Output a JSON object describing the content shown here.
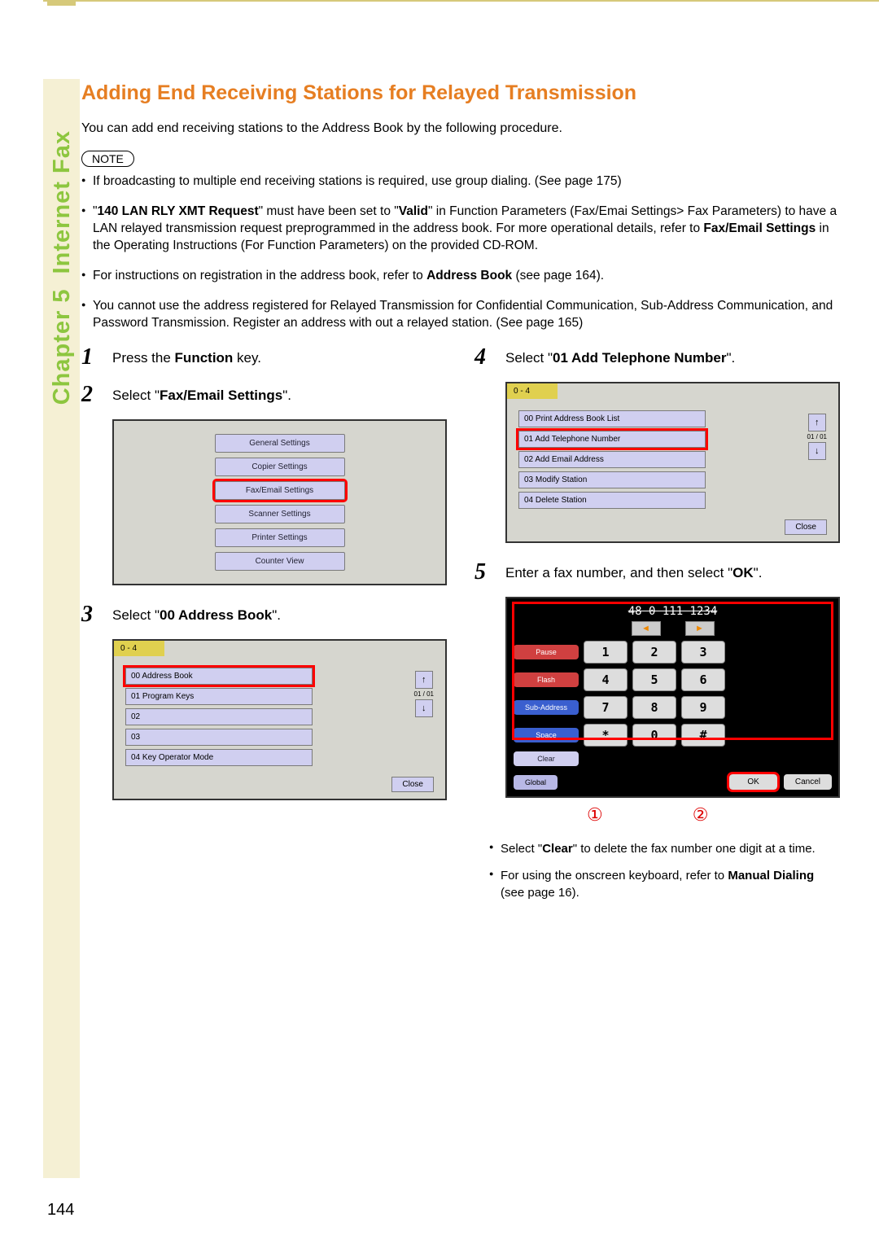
{
  "sidebar": {
    "chapter_label": "Chapter 5",
    "section_label": "Internet Fax"
  },
  "heading": "Adding End Receiving Stations for Relayed Transmission",
  "intro": "You can add end receiving stations to the Address Book by the following procedure.",
  "note_label": "NOTE",
  "notes": {
    "n1": "If broadcasting to multiple end receiving stations is required, use group dialing. (See page 175)",
    "n2a": "\"",
    "n2b": "140 LAN RLY XMT Request",
    "n2c": "\" must have been set to \"",
    "n2d": "Valid",
    "n2e": "\" in Function Parameters (Fax/Emai Settings> Fax Parameters) to have a LAN relayed transmission request preprogrammed in the address book. For more operational details, refer to ",
    "n2f": "Fax/Email Settings",
    "n2g": " in the Operating Instructions (For Function Parameters) on the provided CD-ROM.",
    "n3a": "For instructions on registration in the address book, refer to ",
    "n3b": "Address Book",
    "n3c": " (see page 164).",
    "n4": "You cannot use the address registered for Relayed Transmission for Confidential Communication, Sub-Address Communication, and Password Transmission. Register an address with out a relayed station. (See page 165)"
  },
  "steps": {
    "s1a": "Press the ",
    "s1b": "Function",
    "s1c": " key.",
    "s2a": "Select \"",
    "s2b": "Fax/Email Settings",
    "s2c": "\".",
    "s3a": "Select \"",
    "s3b": "00 Address Book",
    "s3c": "\".",
    "s4a": "Select \"",
    "s4b": "01 Add Telephone Number",
    "s4c": "\".",
    "s5a": "Enter a fax number, and then select \"",
    "s5b": "OK",
    "s5c": "\"."
  },
  "panel1": {
    "items": [
      "General Settings",
      "Copier Settings",
      "Fax/Email Settings",
      "Scanner Settings",
      "Printer Settings",
      "Counter View"
    ]
  },
  "panel3": {
    "hdr": "0 - 4",
    "items": [
      "00  Address Book",
      "01  Program Keys",
      "02",
      "03",
      "04  Key Operator Mode"
    ],
    "close": "Close",
    "page": "01 / 01"
  },
  "panel4": {
    "hdr": "0 - 4",
    "items": [
      "00  Print Address Book List",
      "01  Add Telephone Number",
      "02  Add Email Address",
      "03  Modify Station",
      "04  Delete Station"
    ],
    "close": "Close",
    "page": "01 / 01"
  },
  "keypad": {
    "display": "48 0 111 1234",
    "left": "◄",
    "right": "►",
    "sides": [
      "Pause",
      "Flash",
      "Sub-Address",
      "Space",
      "Clear"
    ],
    "keys": [
      "1",
      "2",
      "3",
      "4",
      "5",
      "6",
      "7",
      "8",
      "9",
      "*",
      "0",
      "#"
    ],
    "global": "Global",
    "ok": "OK",
    "cancel": "Cancel"
  },
  "circles": {
    "c1": "①",
    "c2": "②"
  },
  "sub": {
    "b1a": "Select \"",
    "b1b": "Clear",
    "b1c": "\" to delete the fax number one digit at a time.",
    "b2a": "For using the onscreen keyboard, refer to ",
    "b2b": "Manual Dialing",
    "b2c": " (see page 16)."
  },
  "page_number": "144"
}
